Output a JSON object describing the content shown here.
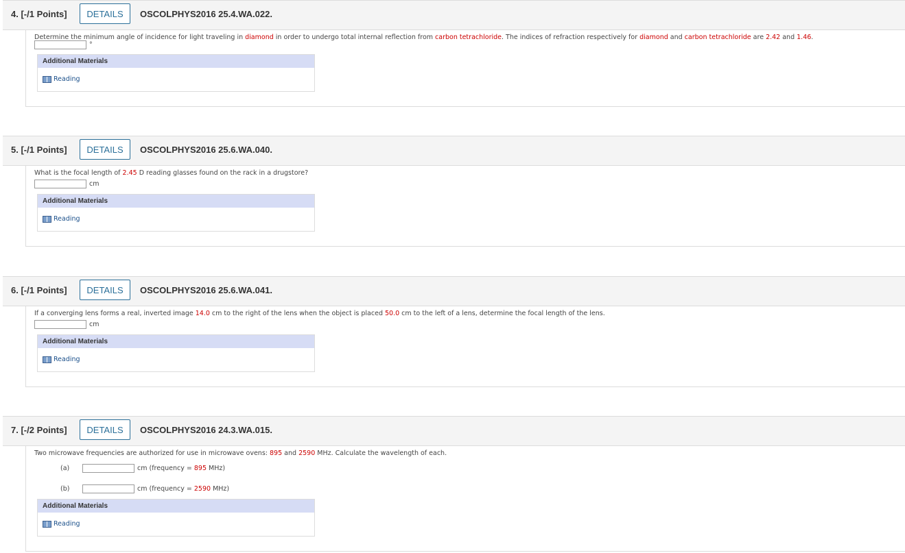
{
  "details_label": "DETAILS",
  "materials_title": "Additional Materials",
  "reading_label": "Reading",
  "questions": [
    {
      "number": "4. [-/1 Points]",
      "code": "OSCOLPHYS2016 25.4.WA.022.",
      "text_parts": [
        "Determine the minimum angle of incidence for light traveling in ",
        "diamond",
        " in order to undergo total internal reflection from ",
        "carbon tetrachloride",
        ". The indices of refraction respectively for ",
        "diamond",
        " and ",
        "carbon tetrachloride",
        " are ",
        "2.42",
        " and ",
        "1.46",
        "."
      ],
      "unit": "°"
    },
    {
      "number": "5. [-/1 Points]",
      "code": "OSCOLPHYS2016 25.6.WA.040.",
      "text_parts": [
        "What is the focal length of ",
        "2.45",
        " D reading glasses found on the rack in a drugstore?"
      ],
      "unit": "cm"
    },
    {
      "number": "6. [-/1 Points]",
      "code": "OSCOLPHYS2016 25.6.WA.041.",
      "text_parts": [
        "If a converging lens forms a real, inverted image ",
        "14.0",
        " cm to the right of the lens when the object is placed ",
        "50.0",
        " cm to the left of a lens, determine the focal length of the lens."
      ],
      "unit": "cm"
    },
    {
      "number": "7. [-/2 Points]",
      "code": "OSCOLPHYS2016 24.3.WA.015.",
      "text_parts": [
        "Two microwave frequencies are authorized for use in microwave ovens: ",
        "895",
        " and ",
        "2590",
        " MHz. Calculate the wavelength of each."
      ],
      "parts": [
        {
          "label": "(a)",
          "pre": "cm (frequency = ",
          "value": "895",
          "post": " MHz)"
        },
        {
          "label": "(b)",
          "pre": "cm (frequency = ",
          "value": "2590",
          "post": " MHz)"
        }
      ]
    }
  ]
}
